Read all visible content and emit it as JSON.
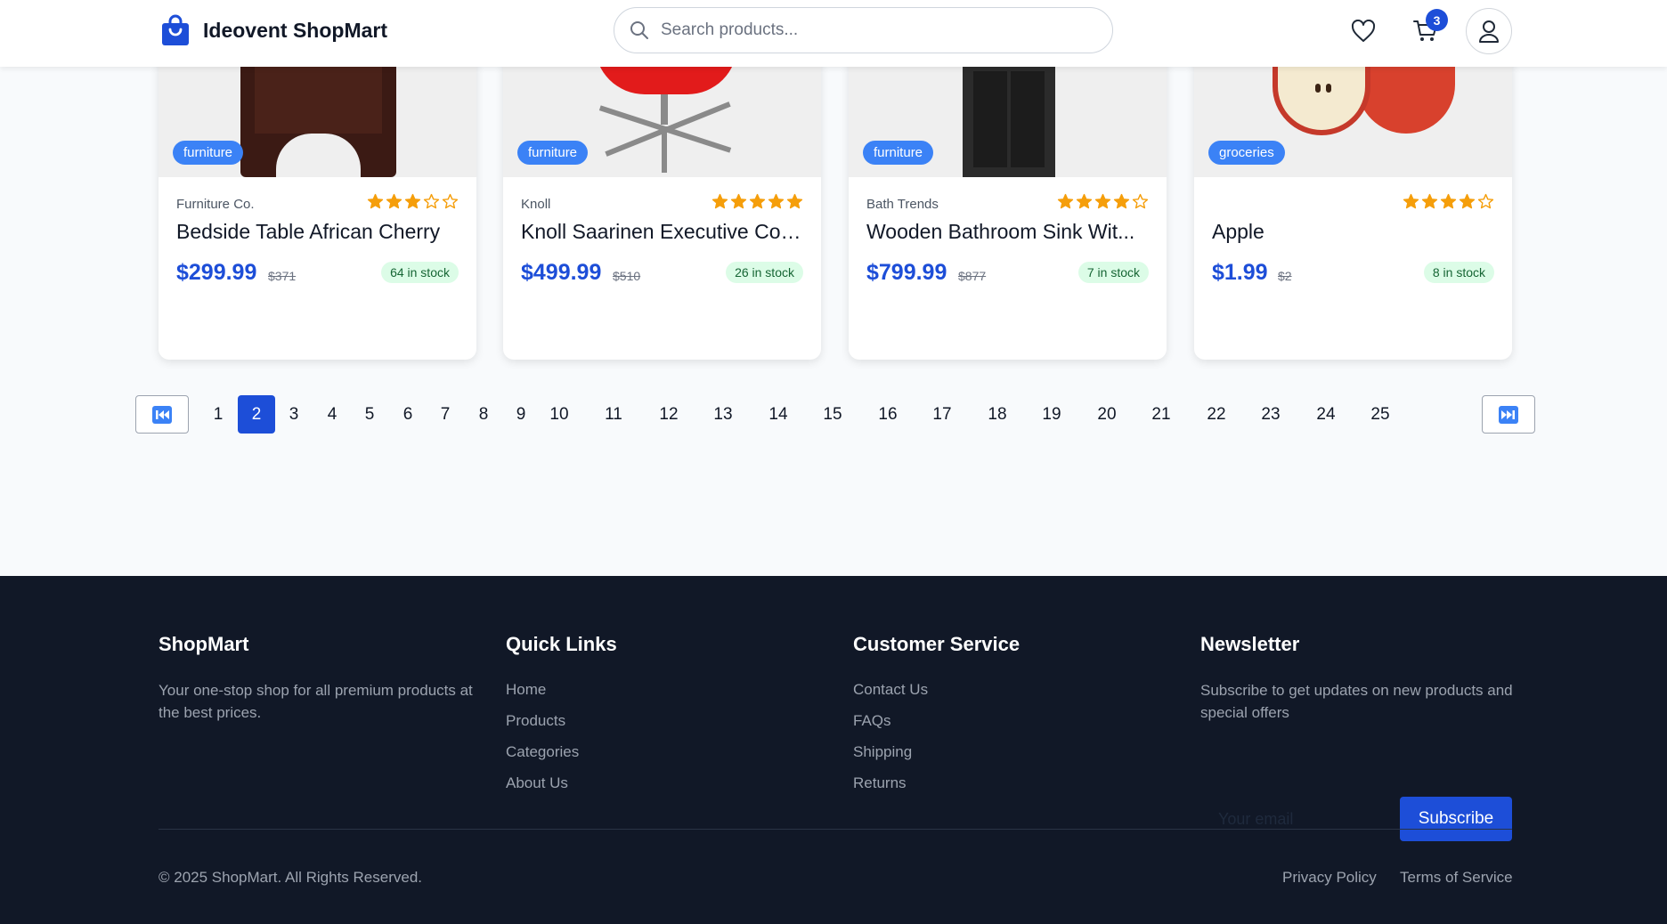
{
  "header": {
    "brand_name": "Ideovent ShopMart",
    "search_placeholder": "Search products...",
    "cart_count": "3"
  },
  "products": [
    {
      "category": "furniture",
      "brand": "Furniture Co.",
      "rating": 3,
      "title": "Bedside Table African Cherry",
      "price": "$299.99",
      "old_price": "$371",
      "stock": "64 in stock"
    },
    {
      "category": "furniture",
      "brand": "Knoll",
      "rating": 5,
      "title": "Knoll Saarinen Executive Con...",
      "price": "$499.99",
      "old_price": "$510",
      "stock": "26 in stock"
    },
    {
      "category": "furniture",
      "brand": "Bath Trends",
      "rating": 4,
      "title": "Wooden Bathroom Sink Wit...",
      "price": "$799.99",
      "old_price": "$877",
      "stock": "7 in stock"
    },
    {
      "category": "groceries",
      "brand": "",
      "rating": 4,
      "title": "Apple",
      "price": "$1.99",
      "old_price": "$2",
      "stock": "8 in stock"
    }
  ],
  "pagination": {
    "first_icon": "first-page-icon",
    "last_icon": "last-page-icon",
    "current": 2,
    "pages": [
      "1",
      "2",
      "3",
      "4",
      "5",
      "6",
      "7",
      "8",
      "9",
      "10",
      "11",
      "12",
      "13",
      "14",
      "15",
      "16",
      "17",
      "18",
      "19",
      "20",
      "21",
      "22",
      "23",
      "24",
      "25"
    ]
  },
  "footer": {
    "about": {
      "heading": "ShopMart",
      "text": "Your one-stop shop for all premium products at the best prices."
    },
    "quick_links": {
      "heading": "Quick Links",
      "links": [
        "Home",
        "Products",
        "Categories",
        "About Us"
      ]
    },
    "customer_service": {
      "heading": "Customer Service",
      "links": [
        "Contact Us",
        "FAQs",
        "Shipping",
        "Returns"
      ]
    },
    "newsletter": {
      "heading": "Newsletter",
      "text": "Subscribe to get updates on new products and special offers",
      "email_placeholder": "Your email",
      "button": "Subscribe"
    },
    "copyright": "© 2025 ShopMart. All Rights Reserved.",
    "privacy": "Privacy Policy",
    "terms": "Terms of Service"
  },
  "colors": {
    "accent": "#1d4ed8",
    "badge": "#3b82f6",
    "star": "#f59e0b",
    "footer_bg": "#111827",
    "stock_bg": "#dcfce7"
  }
}
